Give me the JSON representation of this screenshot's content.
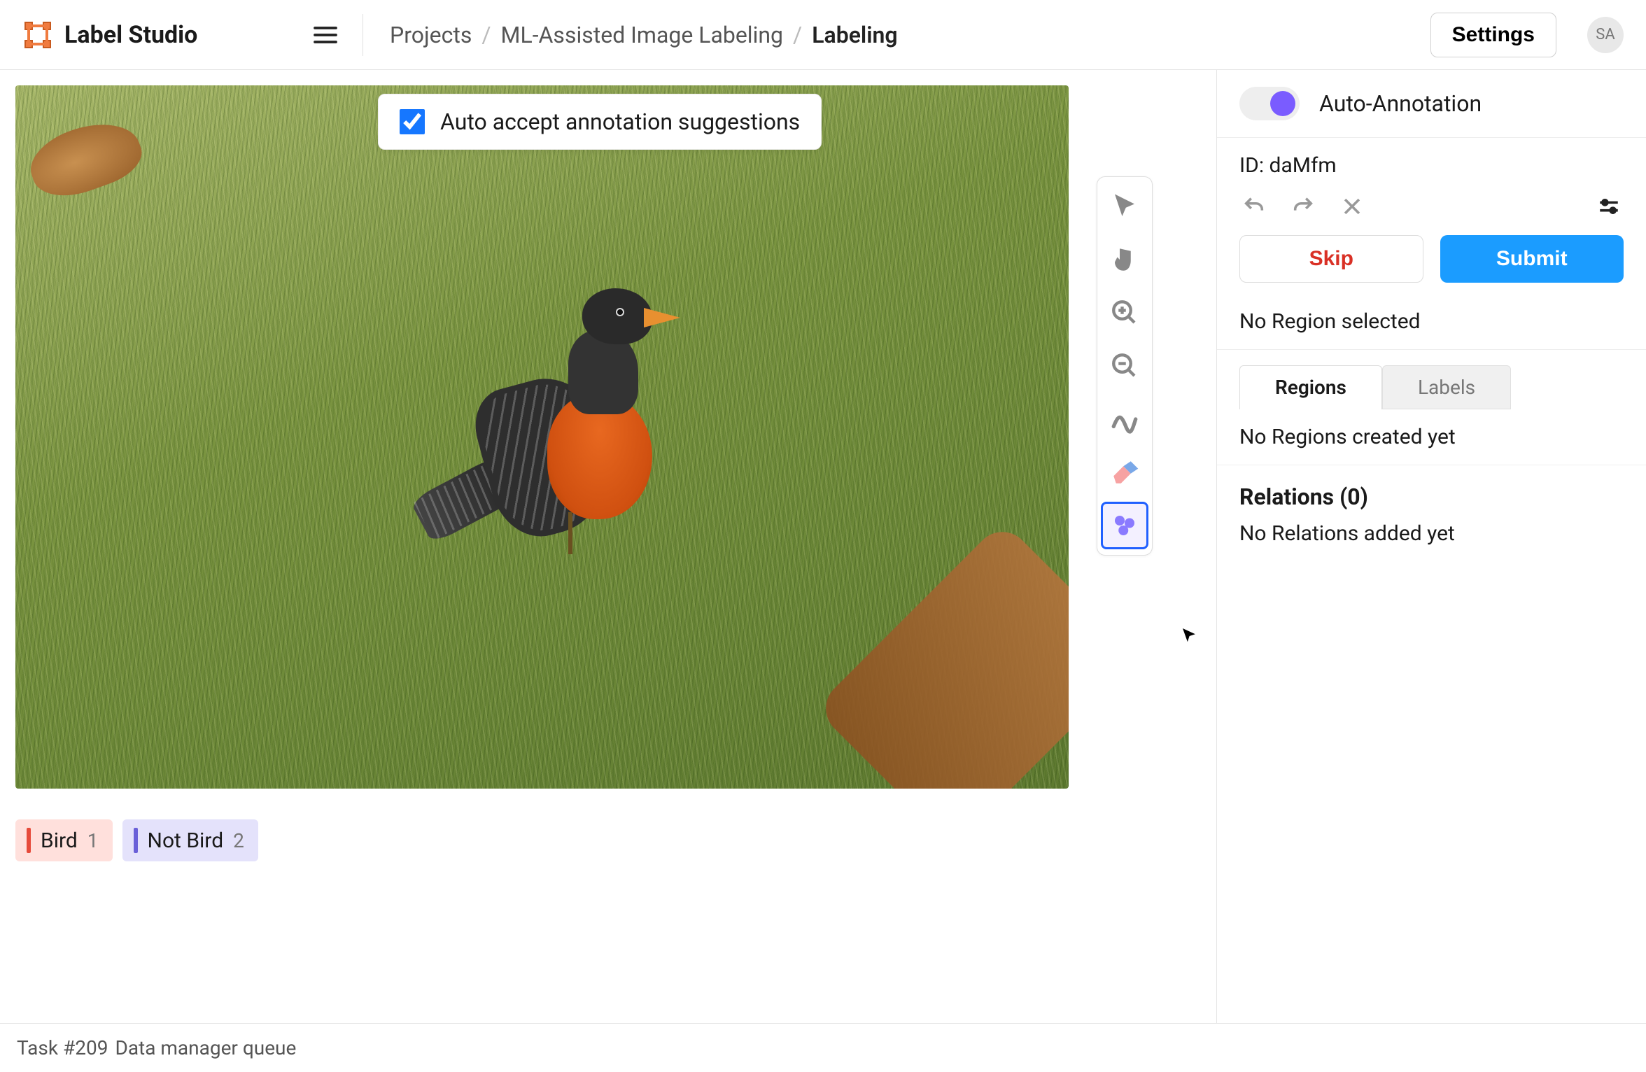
{
  "header": {
    "app_name": "Label Studio",
    "breadcrumb": [
      "Projects",
      "ML-Assisted Image Labeling",
      "Labeling"
    ],
    "settings_label": "Settings",
    "avatar_initials": "SA"
  },
  "auto_accept": {
    "checked": true,
    "label": "Auto accept annotation suggestions"
  },
  "labels": [
    {
      "name": "Bird",
      "hotkey": "1",
      "color": "#e64a3a",
      "bg": "#ffe0dc"
    },
    {
      "name": "Not Bird",
      "hotkey": "2",
      "color": "#6a60d8",
      "bg": "#e4e2fb"
    }
  ],
  "tools": [
    {
      "id": "pointer",
      "icon": "pointer",
      "selected": false
    },
    {
      "id": "hand",
      "icon": "hand",
      "selected": false
    },
    {
      "id": "zoom-in",
      "icon": "zoom-in",
      "selected": false
    },
    {
      "id": "zoom-out",
      "icon": "zoom-out",
      "selected": false
    },
    {
      "id": "brush",
      "icon": "brush",
      "selected": false
    },
    {
      "id": "eraser",
      "icon": "eraser",
      "selected": false
    },
    {
      "id": "smart",
      "icon": "smart",
      "selected": true
    }
  ],
  "sidebar": {
    "auto_annotation_label": "Auto-Annotation",
    "auto_annotation_on": true,
    "id_label": "ID: daMfm",
    "skip_label": "Skip",
    "submit_label": "Submit",
    "region_status": "No Region selected",
    "tabs": {
      "regions": "Regions",
      "labels": "Labels",
      "active": "regions"
    },
    "regions_empty": "No Regions created yet",
    "relations_header": "Relations (0)",
    "relations_empty": "No Relations added yet"
  },
  "footer": {
    "task": "Task #209",
    "queue": "Data manager queue"
  }
}
